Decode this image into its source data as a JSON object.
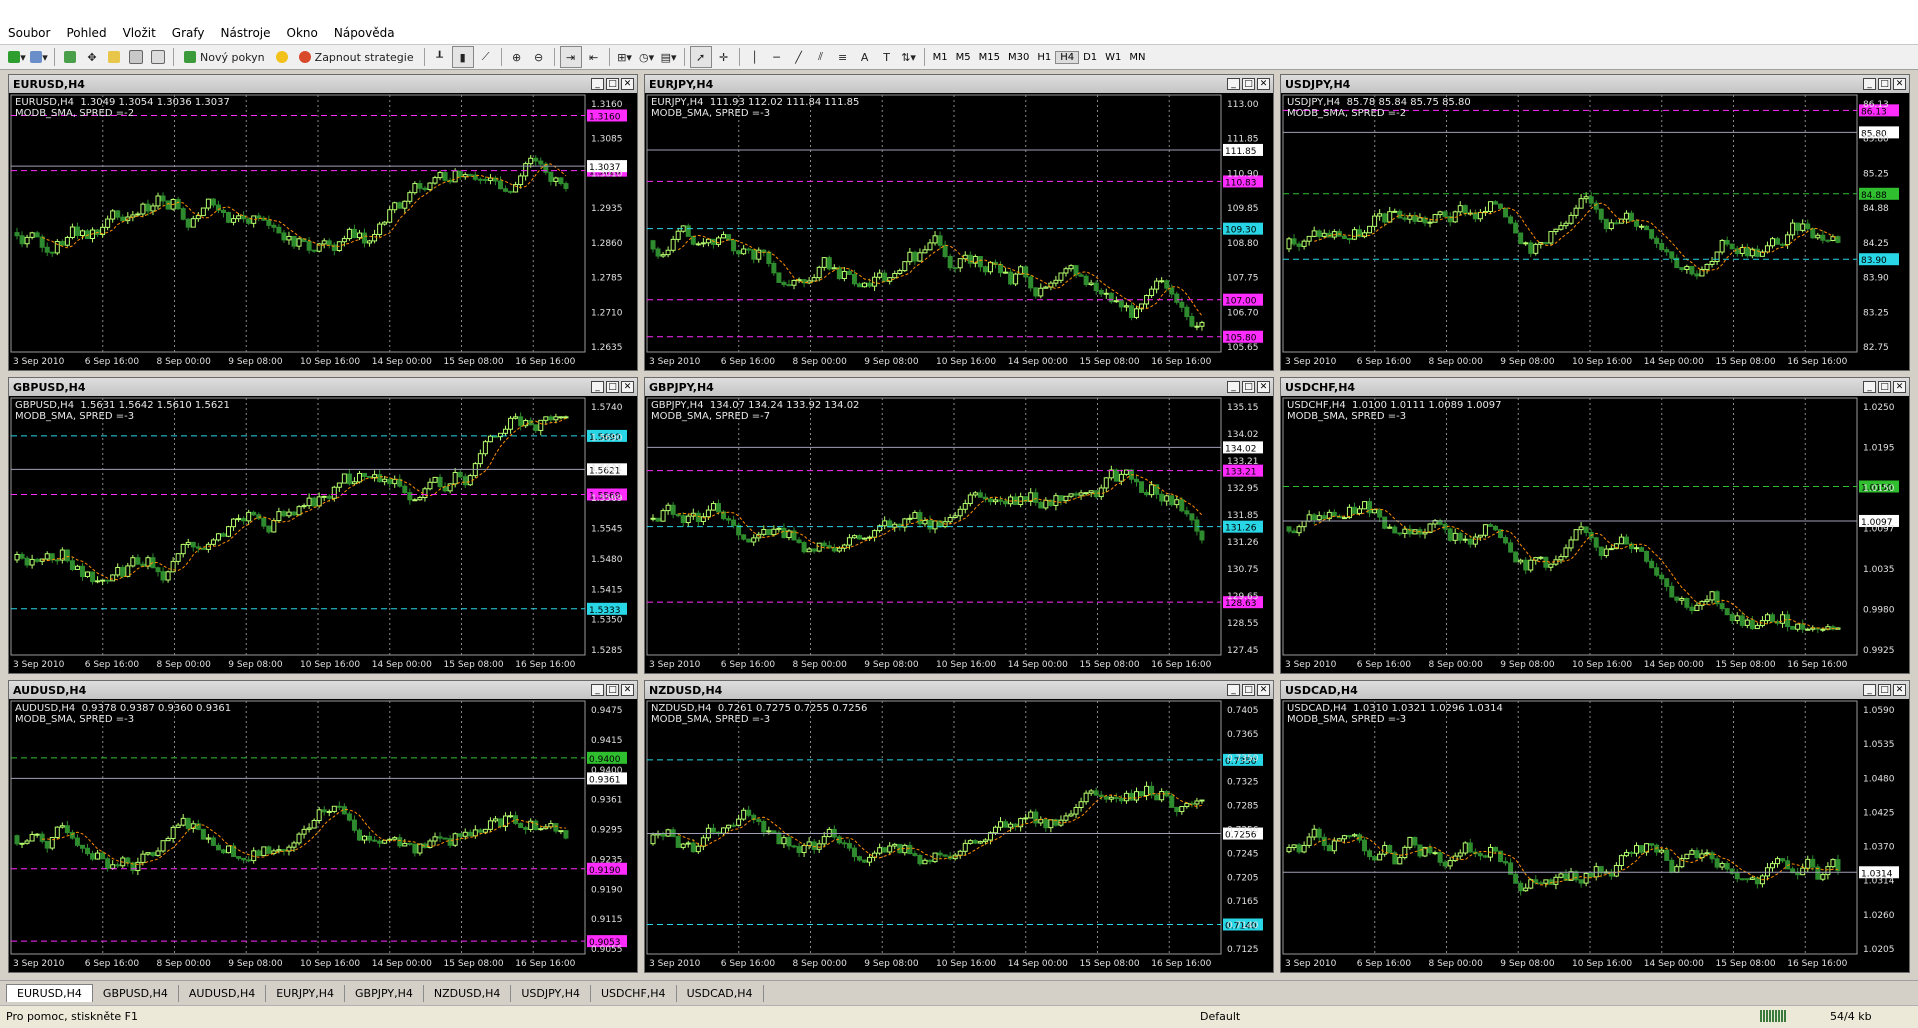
{
  "menu": [
    "Soubor",
    "Pohled",
    "Vložit",
    "Grafy",
    "Nástroje",
    "Okno",
    "Nápověda"
  ],
  "toolbar": {
    "new_order": "Nový pokyn",
    "strategies": "Zapnout strategie",
    "timeframes": [
      "M1",
      "M5",
      "M15",
      "M30",
      "H1",
      "H4",
      "D1",
      "W1",
      "MN"
    ],
    "active_timeframe": "H4"
  },
  "dates": [
    "3 Sep 2010",
    "6 Sep 16:00",
    "8 Sep 00:00",
    "9 Sep 08:00",
    "10 Sep 16:00",
    "14 Sep 00:00",
    "15 Sep 08:00",
    "16 Sep 16:00"
  ],
  "charts": [
    {
      "title": "EURUSD,H4",
      "info1": "EURUSD,H4  1.3049 1.3054 1.3036 1.3037",
      "info2": "MODB_SMA, SPRED =-2",
      "ylabels": [
        "1.3160",
        "1.3085",
        "1.3010",
        "1.2935",
        "1.2860",
        "1.2785",
        "1.2710",
        "1.2635"
      ],
      "ymin": 1.26,
      "ymax": 1.32,
      "current": "1.3037",
      "highlights": [
        {
          "value": "1.3160",
          "kind": "magenta"
        },
        {
          "value": "1.3026",
          "kind": "magenta"
        }
      ],
      "seed": 1
    },
    {
      "title": "EURJPY,H4",
      "info1": "EURJPY,H4  111.93 112.02 111.84 111.85",
      "info2": "MODB_SMA, SPRED =-3",
      "ylabels": [
        "113.00",
        "111.85",
        "110.90",
        "109.85",
        "108.80",
        "107.75",
        "106.70",
        "105.65"
      ],
      "ymin": 105.5,
      "ymax": 113.5,
      "current": "111.85",
      "highlights": [
        {
          "value": "110.83",
          "kind": "magenta"
        },
        {
          "value": "109.30",
          "kind": "cyan"
        },
        {
          "value": "107.00",
          "kind": "magenta"
        },
        {
          "value": "105.80",
          "kind": "magenta"
        }
      ],
      "seed": 2
    },
    {
      "title": "USDJPY,H4",
      "info1": "USDJPY,H4  85.78 85.84 85.75 85.80",
      "info2": "MODB_SMA, SPRED =-2",
      "ylabels": [
        "86.13",
        "85.80",
        "85.25",
        "84.88",
        "84.25",
        "83.90",
        "83.25",
        "82.75"
      ],
      "ymin": 82.6,
      "ymax": 86.3,
      "current": "85.80",
      "highlights": [
        {
          "value": "86.13",
          "kind": "magenta"
        },
        {
          "value": "84.88",
          "kind": "green"
        },
        {
          "value": "83.90",
          "kind": "cyan"
        }
      ],
      "seed": 3
    },
    {
      "title": "GBPUSD,H4",
      "info1": "GBPUSD,H4  1.5631 1.5642 1.5610 1.5621",
      "info2": "MODB_SMA, SPRED =-3",
      "ylabels": [
        "1.5740",
        "1.5690",
        "1.5621",
        "1.5569",
        "1.5545",
        "1.5480",
        "1.5415",
        "1.5350",
        "1.5285"
      ],
      "ymin": 1.525,
      "ymax": 1.576,
      "current": "1.5621",
      "highlights": [
        {
          "value": "1.5690",
          "kind": "cyan"
        },
        {
          "value": "1.5569",
          "kind": "magenta"
        },
        {
          "value": "1.5333",
          "kind": "cyan"
        }
      ],
      "seed": 4
    },
    {
      "title": "GBPJPY,H4",
      "info1": "GBPJPY,H4  134.07 134.24 133.92 134.02",
      "info2": "MODB_SMA, SPRED =-7",
      "ylabels": [
        "135.15",
        "134.02",
        "133.21",
        "132.95",
        "131.85",
        "131.26",
        "130.75",
        "129.65",
        "128.55",
        "127.45"
      ],
      "ymin": 127.0,
      "ymax": 135.6,
      "current": "134.02",
      "highlights": [
        {
          "value": "133.21",
          "kind": "magenta"
        },
        {
          "value": "131.26",
          "kind": "cyan"
        },
        {
          "value": "128.63",
          "kind": "magenta"
        }
      ],
      "seed": 5
    },
    {
      "title": "USDCHF,H4",
      "info1": "USDCHF,H4  1.0100 1.0111 1.0089 1.0097",
      "info2": "MODB_SMA, SPRED =-3",
      "ylabels": [
        "1.0250",
        "1.0195",
        "1.0150",
        "1.0097",
        "1.0035",
        "0.9980",
        "0.9925"
      ],
      "ymin": 0.99,
      "ymax": 1.028,
      "current": "1.0097",
      "highlights": [
        {
          "value": "1.0150",
          "kind": "green"
        }
      ],
      "seed": 6
    },
    {
      "title": "AUDUSD,H4",
      "info1": "AUDUSD,H4  0.9378 0.9387 0.9360 0.9361",
      "info2": "MODB_SMA, SPRED =-3",
      "ylabels": [
        "0.9475",
        "0.9415",
        "0.9400",
        "0.9361",
        "0.9295",
        "0.9235",
        "0.9190",
        "0.9115",
        "0.9055"
      ],
      "ymin": 0.904,
      "ymax": 0.95,
      "current": "0.9361",
      "highlights": [
        {
          "value": "0.9400",
          "kind": "green"
        },
        {
          "value": "0.9190",
          "kind": "magenta"
        },
        {
          "value": "0.9053",
          "kind": "magenta"
        }
      ],
      "seed": 7
    },
    {
      "title": "NZDUSD,H4",
      "info1": "NZDUSD,H4  0.7261 0.7275 0.7255 0.7256",
      "info2": "MODB_SMA, SPRED =-3",
      "ylabels": [
        "0.7405",
        "0.7365",
        "0.7350",
        "0.7325",
        "0.7285",
        "0.7256",
        "0.7245",
        "0.7205",
        "0.7165",
        "0.7140",
        "0.7125"
      ],
      "ymin": 0.711,
      "ymax": 0.742,
      "current": "0.7256",
      "highlights": [
        {
          "value": "0.7350",
          "kind": "cyan"
        },
        {
          "value": "0.7140",
          "kind": "cyan"
        }
      ],
      "seed": 8
    },
    {
      "title": "USDCAD,H4",
      "info1": "USDCAD,H4  1.0310 1.0321 1.0296 1.0314",
      "info2": "MODB_SMA, SPRED =-3",
      "ylabels": [
        "1.0590",
        "1.0535",
        "1.0480",
        "1.0425",
        "1.0370",
        "1.0314",
        "1.0260",
        "1.0205"
      ],
      "ymin": 1.018,
      "ymax": 1.061,
      "current": "1.0314",
      "highlights": [],
      "seed": 9
    }
  ],
  "tabs": [
    "EURUSD,H4",
    "GBPUSD,H4",
    "AUDUSD,H4",
    "EURJPY,H4",
    "GBPJPY,H4",
    "NZDUSD,H4",
    "USDJPY,H4",
    "USDCHF,H4",
    "USDCAD,H4"
  ],
  "status": {
    "help": "Pro pomoc, stiskněte F1",
    "profile": "Default",
    "traffic": "54/4 kb"
  },
  "colors": {
    "bull": "#b6ff6e",
    "bear": "#2e8b2e",
    "grid": "#888888",
    "sma": "#ff8c00",
    "magenta": "#ff2bff",
    "cyan": "#29d6e6",
    "green": "#2fbf2f"
  }
}
